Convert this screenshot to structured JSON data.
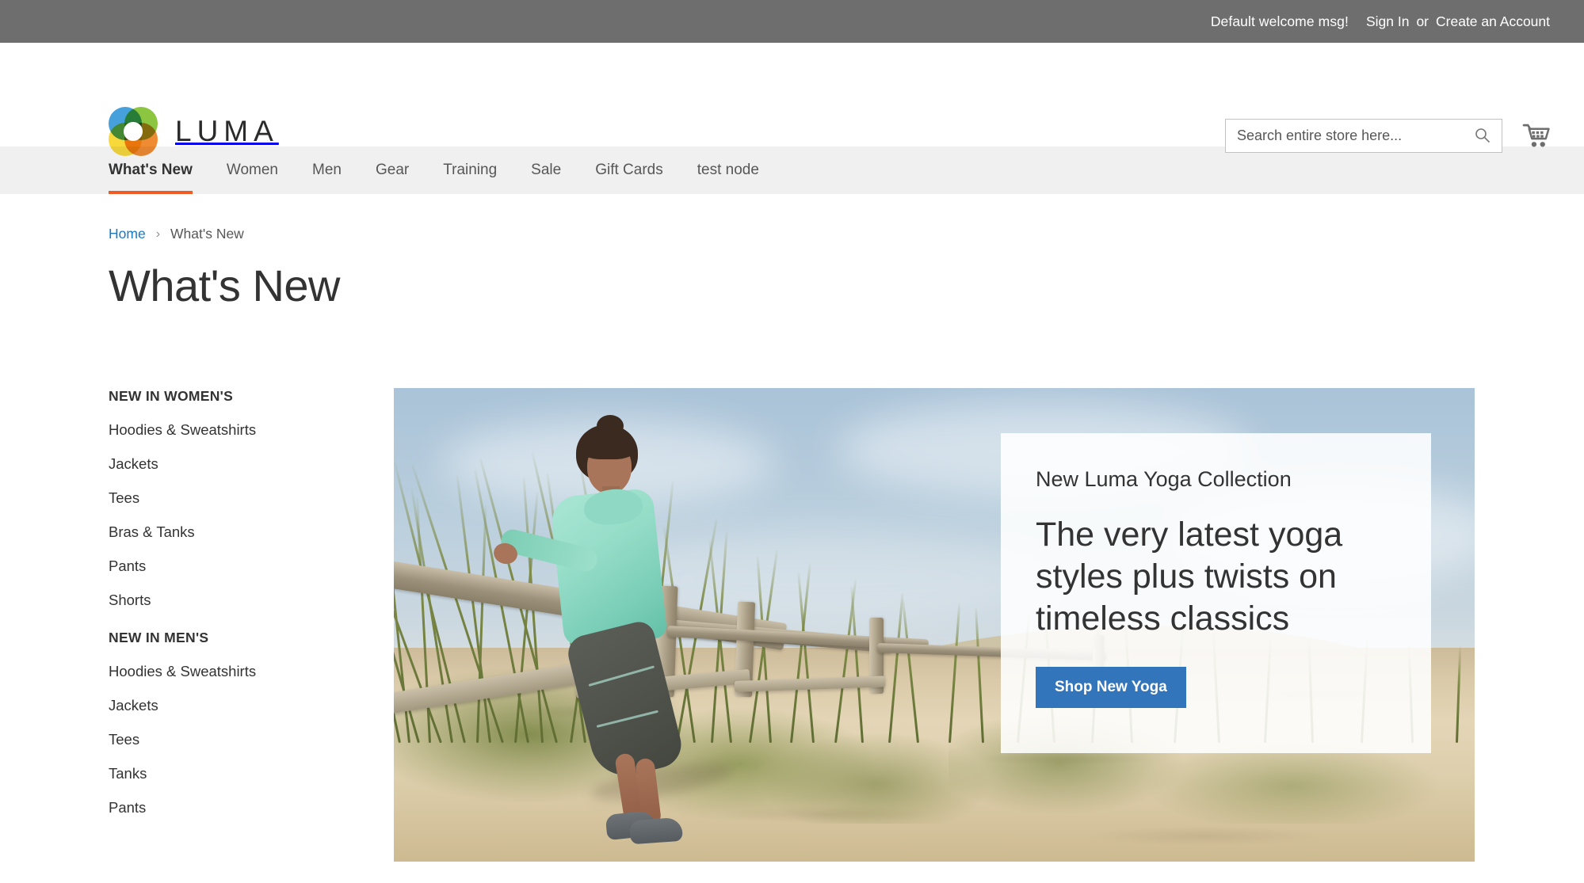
{
  "top_panel": {
    "welcome": "Default welcome msg!",
    "sign_in": "Sign In",
    "or": "or",
    "create_account": "Create an Account"
  },
  "header": {
    "logo_text": "LUMA",
    "search": {
      "placeholder": "Search entire store here...",
      "value": ""
    }
  },
  "nav": {
    "items": [
      {
        "label": "What's New",
        "active": true
      },
      {
        "label": "Women",
        "active": false
      },
      {
        "label": "Men",
        "active": false
      },
      {
        "label": "Gear",
        "active": false
      },
      {
        "label": "Training",
        "active": false
      },
      {
        "label": "Sale",
        "active": false
      },
      {
        "label": "Gift Cards",
        "active": false
      },
      {
        "label": "test node",
        "active": false
      }
    ]
  },
  "breadcrumb": {
    "home": "Home",
    "separator": "›",
    "current": "What's New"
  },
  "page": {
    "title": "What's New"
  },
  "sidebar": {
    "groups": [
      {
        "heading": "NEW IN WOMEN'S",
        "links": [
          "Hoodies & Sweatshirts",
          "Jackets",
          "Tees",
          "Bras & Tanks",
          "Pants",
          "Shorts"
        ]
      },
      {
        "heading": "NEW IN MEN'S",
        "links": [
          "Hoodies & Sweatshirts",
          "Jackets",
          "Tees",
          "Tanks",
          "Pants"
        ]
      }
    ]
  },
  "hero": {
    "promo": {
      "eyebrow": "New Luma Yoga Collection",
      "title": "The very latest yoga styles plus twists on timeless classics",
      "button": "Shop New Yoga"
    }
  },
  "colors": {
    "top_panel_bg": "#6e6e6e",
    "nav_bg": "#f0f0f0",
    "active_underline": "#ef5b25",
    "link_blue": "#1979c3",
    "button_blue": "#3275bb",
    "text_dark": "#333333",
    "text_muted": "#575757",
    "logo_blue": "#46a0db",
    "logo_green": "#8cc540",
    "logo_orange": "#ef8b33",
    "logo_yellow": "#f8d93c"
  },
  "icons": {
    "search": "search-icon",
    "cart": "cart-icon"
  }
}
